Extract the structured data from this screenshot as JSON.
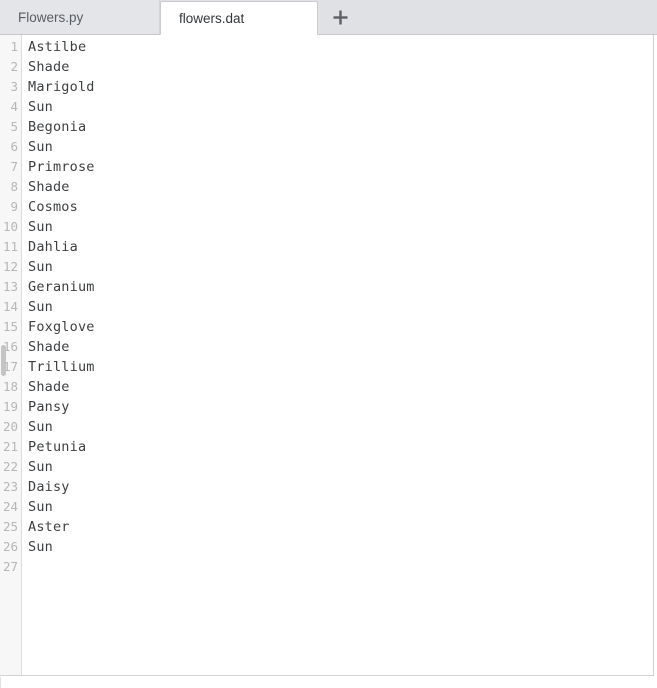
{
  "tabs": [
    {
      "label": "Flowers.py",
      "active": false
    },
    {
      "label": "flowers.dat",
      "active": true
    }
  ],
  "new_tab": {
    "icon": "plus-icon",
    "label": "+"
  },
  "editor": {
    "filename": "flowers.dat",
    "total_lines": 27,
    "lines": [
      {
        "number": "1",
        "text": "Astilbe"
      },
      {
        "number": "2",
        "text": "Shade"
      },
      {
        "number": "3",
        "text": "Marigold"
      },
      {
        "number": "4",
        "text": "Sun"
      },
      {
        "number": "5",
        "text": "Begonia"
      },
      {
        "number": "6",
        "text": "Sun"
      },
      {
        "number": "7",
        "text": "Primrose"
      },
      {
        "number": "8",
        "text": "Shade"
      },
      {
        "number": "9",
        "text": "Cosmos"
      },
      {
        "number": "10",
        "text": "Sun"
      },
      {
        "number": "11",
        "text": "Dahlia"
      },
      {
        "number": "12",
        "text": "Sun"
      },
      {
        "number": "13",
        "text": "Geranium"
      },
      {
        "number": "14",
        "text": "Sun"
      },
      {
        "number": "15",
        "text": "Foxglove"
      },
      {
        "number": "16",
        "text": "Shade"
      },
      {
        "number": "17",
        "text": "Trillium"
      },
      {
        "number": "18",
        "text": "Shade"
      },
      {
        "number": "19",
        "text": "Pansy"
      },
      {
        "number": "20",
        "text": "Sun"
      },
      {
        "number": "21",
        "text": "Petunia"
      },
      {
        "number": "22",
        "text": "Sun"
      },
      {
        "number": "23",
        "text": "Daisy"
      },
      {
        "number": "24",
        "text": "Sun"
      },
      {
        "number": "25",
        "text": "Aster"
      },
      {
        "number": "26",
        "text": "Sun"
      },
      {
        "number": "27",
        "text": ""
      }
    ]
  },
  "colors": {
    "tabbar_bg": "#dfe1e5",
    "inactive_tab_bg": "#e3e5e8",
    "active_tab_bg": "#ffffff",
    "gutter_bg": "#f7f7f7",
    "line_number": "#b6b6b6",
    "code_text": "#3c3f41",
    "border": "#cfd1d5",
    "scrollbar_thumb": "#c3c4c6"
  }
}
